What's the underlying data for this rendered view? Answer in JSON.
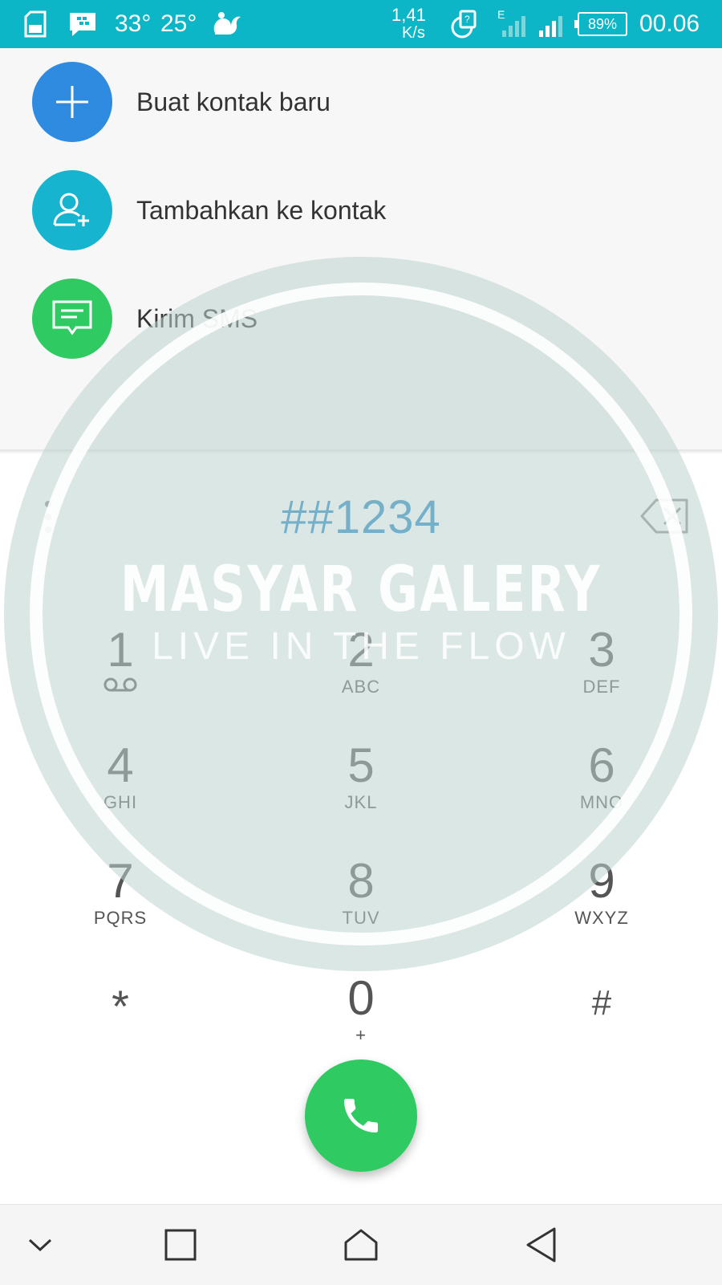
{
  "status_bar": {
    "temperature_1": "33°",
    "temperature_2": "25°",
    "net_speed_value": "1,41",
    "net_speed_unit": "K/s",
    "network_type": "E",
    "battery": "89%",
    "time": "00.06"
  },
  "actions": [
    {
      "label": "Buat kontak baru",
      "icon": "plus-icon",
      "color": "#2f8be0"
    },
    {
      "label": "Tambahkan ke kontak",
      "icon": "add-person-icon",
      "color": "#17b4cf"
    },
    {
      "label": "Kirim SMS",
      "icon": "message-icon",
      "color": "#2fcb62"
    }
  ],
  "dialer": {
    "number": "##1234",
    "keys": [
      {
        "digit": "1",
        "letters": ""
      },
      {
        "digit": "2",
        "letters": "ABC"
      },
      {
        "digit": "3",
        "letters": "DEF"
      },
      {
        "digit": "4",
        "letters": "GHI"
      },
      {
        "digit": "5",
        "letters": "JKL"
      },
      {
        "digit": "6",
        "letters": "MNO"
      },
      {
        "digit": "7",
        "letters": "PQRS"
      },
      {
        "digit": "8",
        "letters": "TUV"
      },
      {
        "digit": "9",
        "letters": "WXYZ"
      },
      {
        "digit": "*",
        "letters": ""
      },
      {
        "digit": "0",
        "letters": "+"
      },
      {
        "digit": "#",
        "letters": ""
      }
    ]
  },
  "watermark": {
    "title": "MASYAR GALERY",
    "subtitle": "LIVE IN THE FLOW"
  },
  "colors": {
    "status_bar": "#0cb6c6",
    "number_text": "#1e86c6",
    "call_button": "#2fcb62"
  }
}
